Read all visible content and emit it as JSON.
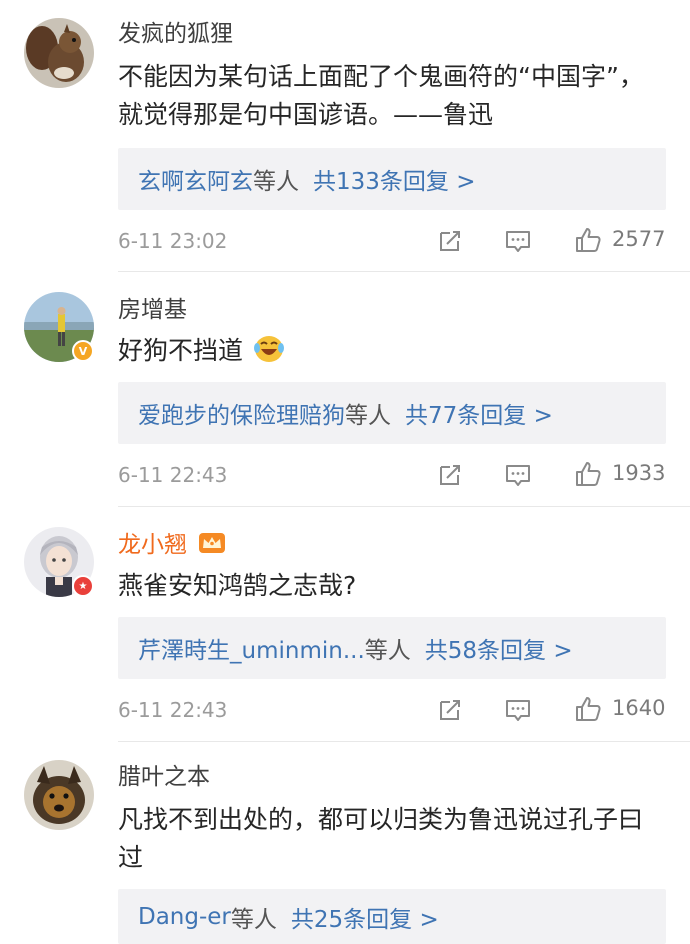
{
  "comments": [
    {
      "username": "发疯的狐狸",
      "text": "不能因为某句话上面配了个鬼画符的“中国字”，就觉得那是句中国谚语。——鲁迅",
      "reply_names": "玄啊玄阿玄",
      "reply_who": "等人",
      "reply_count": "共133条回复 >",
      "time": "6-11 23:02",
      "likes": "2577",
      "avatar_icon": "squirrel-avatar"
    },
    {
      "username": "房增基",
      "text": "好狗不挡道",
      "emoji": "laughing-crying-emoji",
      "reply_names": "爱跑步的保险理赔狗",
      "reply_who": "等人",
      "reply_count": "共77条回复 >",
      "time": "6-11 22:43",
      "likes": "1933",
      "avatar_icon": "golfer-avatar",
      "badge": "verified-v-badge"
    },
    {
      "username": "龙小翘",
      "text": "燕雀安知鸿鹄之志哉?",
      "reply_names": "芹澤時生_uminmin...",
      "reply_who": "等人",
      "reply_count": "共58条回复 >",
      "time": "6-11 22:43",
      "likes": "1640",
      "avatar_icon": "anime-boy-avatar",
      "badge": "red-star-badge",
      "vip_icon": "crown-icon"
    },
    {
      "username": "腊叶之本",
      "text": "凡找不到出处的，都可以归类为鲁迅说过孔子曰过",
      "reply_names": "Dang-er",
      "reply_who": "等人",
      "reply_count": "共25条回复 >",
      "avatar_icon": "dog-avatar"
    }
  ],
  "colors": {
    "link_blue": "#3f74b3",
    "vip_orange": "#f06a1d",
    "reply_bg": "#f2f2f4"
  }
}
